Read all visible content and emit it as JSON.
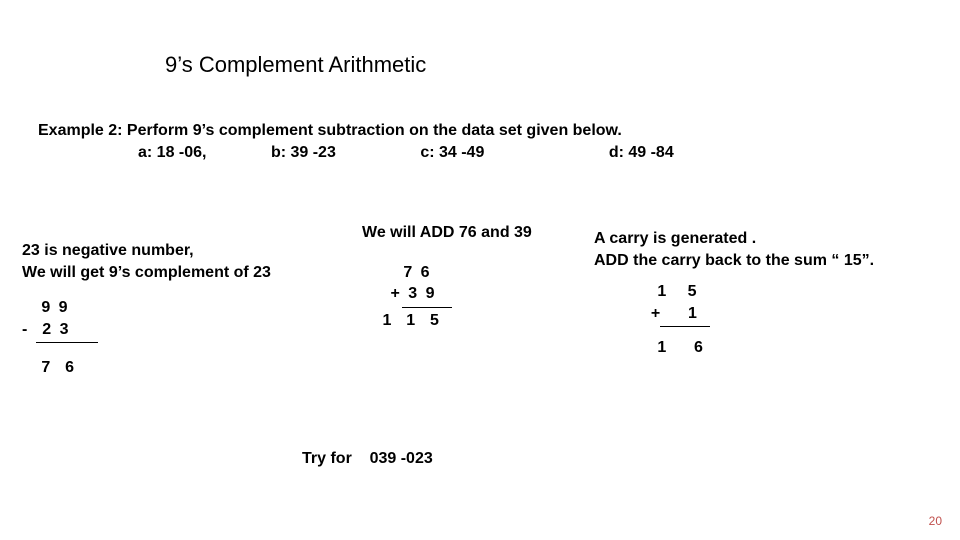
{
  "title": "9’s Complement Arithmetic",
  "example": "Example 2: Perform  9’s complement subtraction on the data set given below.",
  "parts": {
    "a": "a:  18 -06,",
    "b": "b: 39 -23",
    "c": "c: 34 -49",
    "d": "d: 49 -84"
  },
  "col1": {
    "text1": "23 is negative number,",
    "text2": "We will get 9’s complement of  23",
    "l1": "   9 9",
    "l2": "-  2 3",
    "l3": "   7  6"
  },
  "col2": {
    "text1": "We will ADD 76 and 39",
    "l1": "   7 6",
    "l2": " + 3 9",
    "l3": " 1  1  5"
  },
  "col3": {
    "text1": "A carry is generated .",
    "text2": "ADD the carry back to the sum “ 15”.",
    "l1": "   1   5",
    "l2": "  +    1",
    "l3": "   1    6"
  },
  "try_label": "Try for",
  "try_value": "039 -023",
  "page_number": "20"
}
